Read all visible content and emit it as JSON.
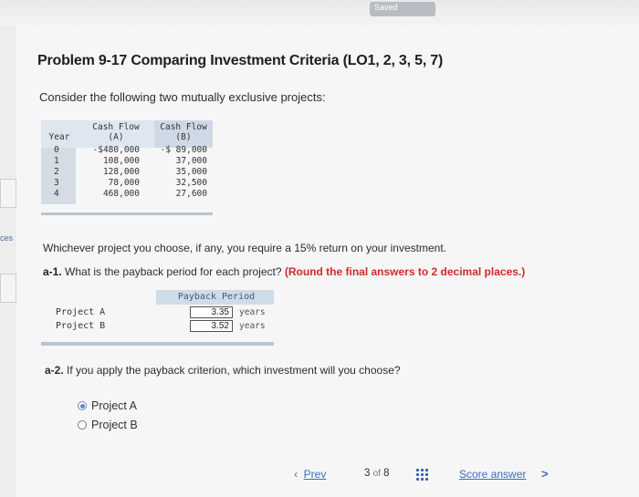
{
  "header": {
    "saved_label": "Saved"
  },
  "sidebar": {
    "label": "ces"
  },
  "problem": {
    "title": "Problem 9-17 Comparing Investment Criteria (LO1, 2, 3, 5, 7)",
    "intro": "Consider the following two mutually exclusive projects:"
  },
  "cash_flow_table": {
    "headers": {
      "year": "Year",
      "cfA_1": "Cash Flow",
      "cfA_2": "(A)",
      "cfB_1": "Cash Flow",
      "cfB_2": "(B)"
    },
    "rows": [
      {
        "year": "0",
        "a": "-$480,000",
        "b": "-$ 89,000"
      },
      {
        "year": "1",
        "a": "108,000",
        "b": "37,000"
      },
      {
        "year": "2",
        "a": "128,000",
        "b": "35,000"
      },
      {
        "year": "3",
        "a": "78,000",
        "b": "32,500"
      },
      {
        "year": "4",
        "a": "468,000",
        "b": "27,600"
      }
    ]
  },
  "question": {
    "text": "Whichever project you choose, if any, you require a 15% return on your investment.",
    "a1_label": "a-1.",
    "a1_text": "What is the payback period for each project?",
    "a1_note": "(Round the final answers to 2 decimal places.)",
    "a2_label": "a-2.",
    "a2_text": "If you apply the payback criterion, which investment will you choose?"
  },
  "payback_table": {
    "header": "Payback Period",
    "rows": [
      {
        "label": "Project A",
        "value": "3.35",
        "unit": "years"
      },
      {
        "label": "Project B",
        "value": "3.52",
        "unit": "years"
      }
    ]
  },
  "options": [
    {
      "label": "Project A",
      "selected": true
    },
    {
      "label": "Project B",
      "selected": false
    }
  ],
  "footer": {
    "prev_label": "Prev",
    "page_current": "3",
    "page_of": "of",
    "page_total": "8",
    "score_label": "Score answer",
    "next_glyph": ">"
  }
}
